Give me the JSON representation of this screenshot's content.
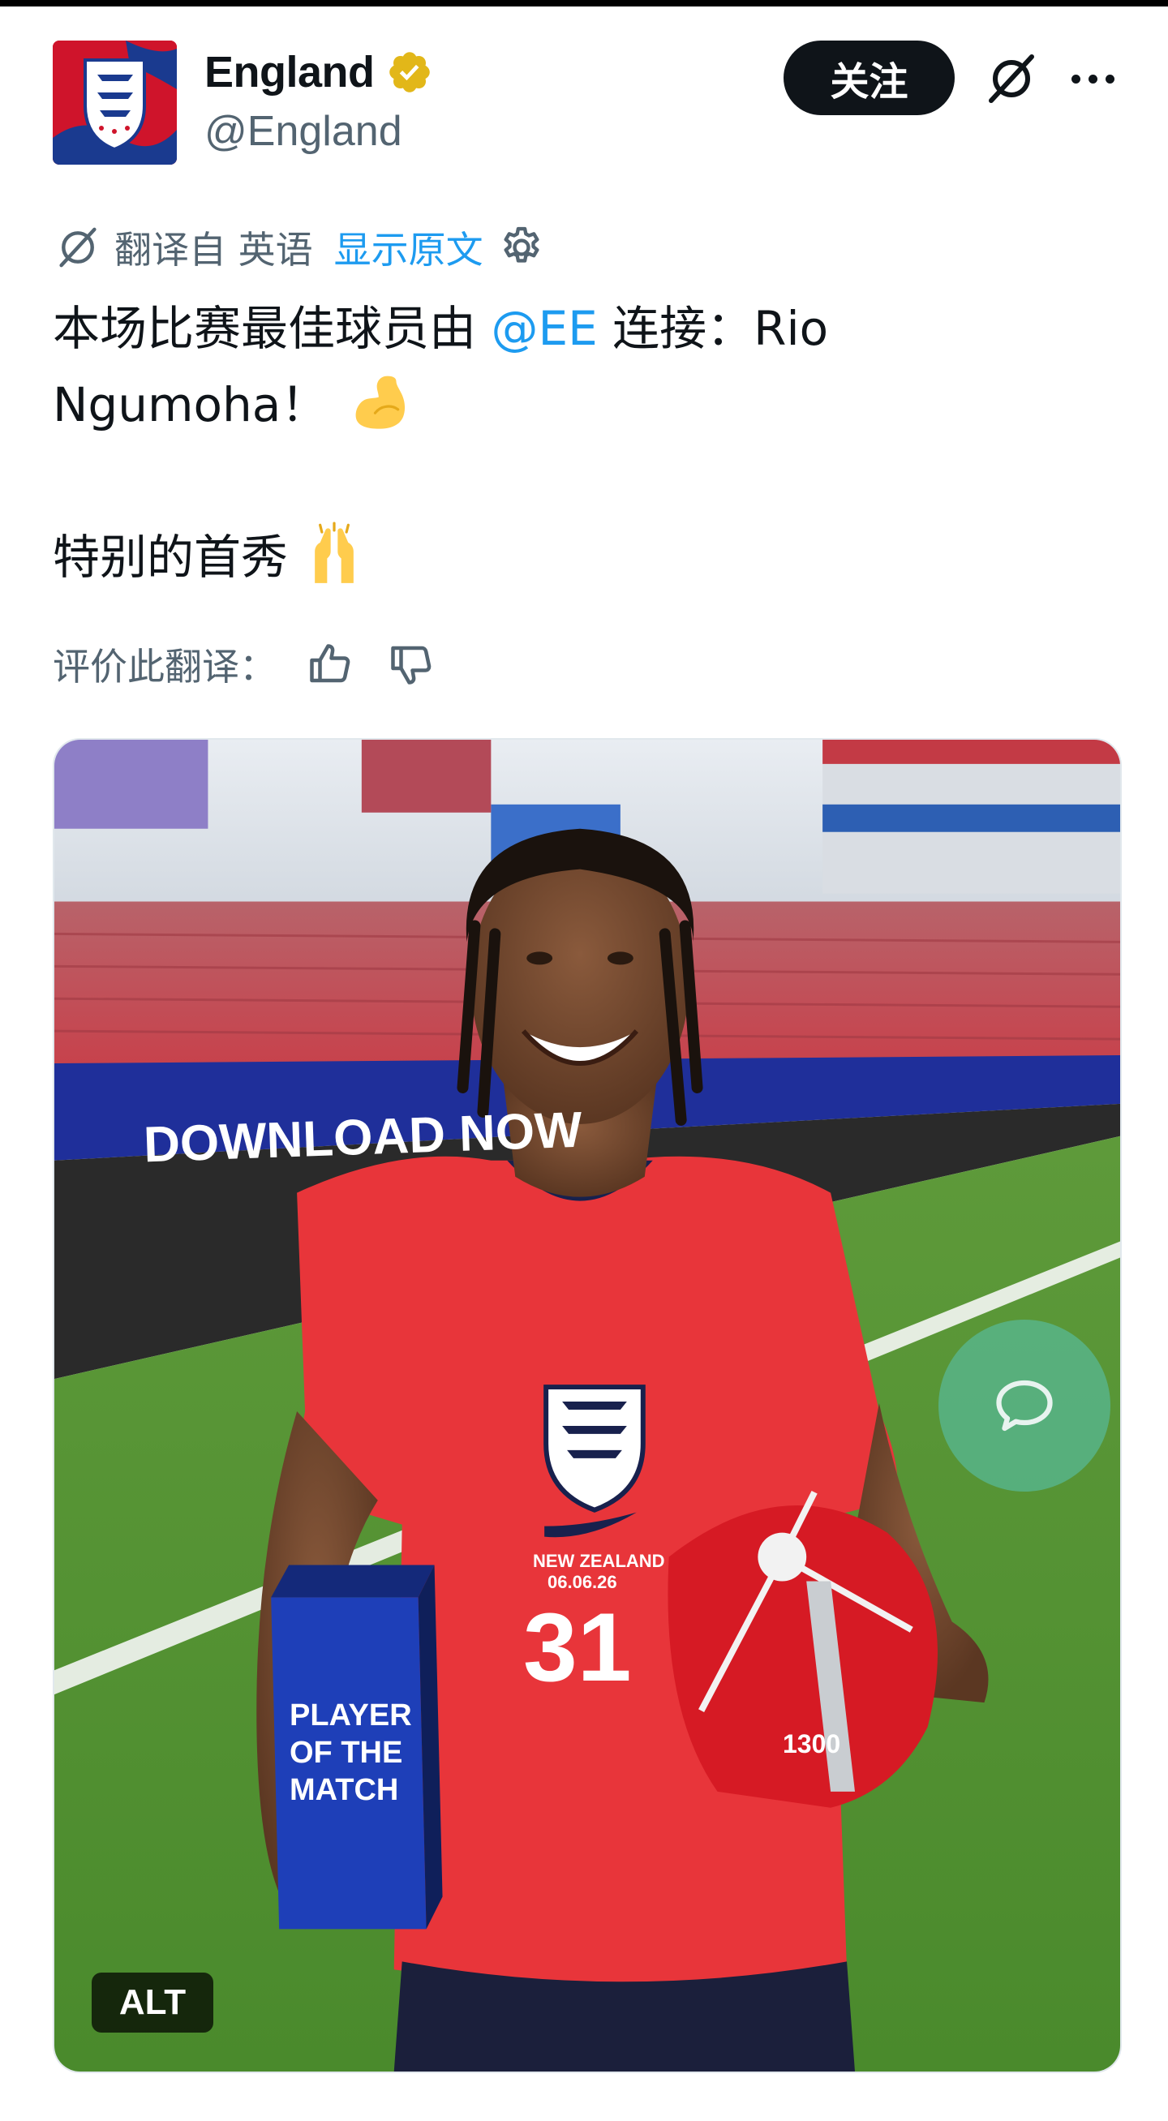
{
  "header": {
    "display_name": "England",
    "handle": "@England",
    "verified": true,
    "follow_label": "关注",
    "grok_icon": "grok-icon",
    "more_icon": "more-icon"
  },
  "translation": {
    "translated_from": "翻译自 英语",
    "show_original": "显示原文",
    "settings_icon": "gear-icon"
  },
  "tweet": {
    "line1_pre": "本场比赛最佳球员由 ",
    "mention": "@EE",
    "line1_post": " 连接：Rio",
    "line2": "Ngumoha！",
    "line3": "特别的首秀",
    "emoji1": "flexed-biceps",
    "emoji2": "raising-hands"
  },
  "rating": {
    "label": "评价此翻译："
  },
  "media": {
    "alt_label": "ALT",
    "banner_text": "DOWNLOAD NOW",
    "shirt_text": "NEW ZEALAND",
    "shirt_date": "06.06.26",
    "shirt_number": "31",
    "cap_number": "1300",
    "trophy_line1": "PLAYER",
    "trophy_line2": "OF THE",
    "trophy_line3": "MATCH"
  },
  "colors": {
    "accent_blue": "#1d9bf0",
    "text_primary": "#0f1419",
    "text_secondary": "#536471",
    "verified_gold": "#e2b719",
    "england_red": "#cf142b"
  }
}
